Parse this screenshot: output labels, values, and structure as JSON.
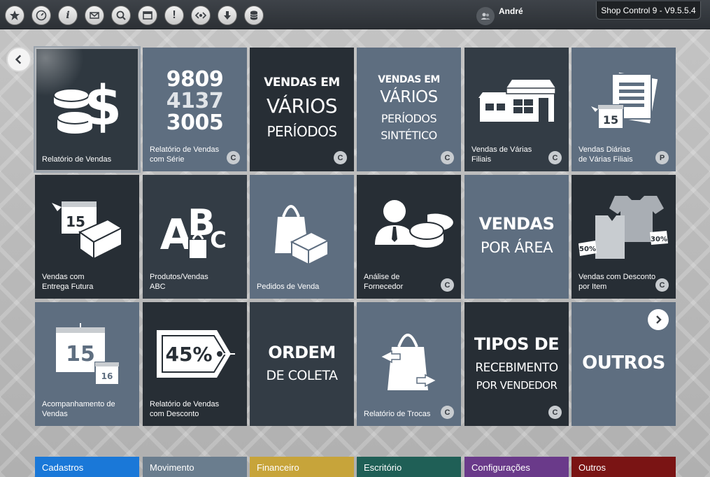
{
  "topbar": {
    "icons": [
      "star-icon",
      "dashboard-gauge-icon",
      "info-icon",
      "mail-icon",
      "search-icon",
      "window-icon",
      "alert-icon",
      "code-icon",
      "download-icon",
      "database-icon"
    ],
    "info_glyph": "i",
    "alert_glyph": "!",
    "user_name": "André",
    "version": "Shop Control 9 - V9.5.5.4"
  },
  "tiles": [
    {
      "label": "Relatório de Vendas",
      "badge": "",
      "color": "#2f3840"
    },
    {
      "label": "Relatório de Vendas\ncom Série",
      "badge": "C",
      "color": "#5e6e80",
      "numbers": [
        "9809",
        "4137",
        "3005"
      ]
    },
    {
      "label": "",
      "badge": "C",
      "color": "#272e35",
      "line1": "VENDAS EM",
      "line2": "VÁRIOS",
      "line3": "PERÍODOS"
    },
    {
      "label": "",
      "badge": "C",
      "color": "#5e6e80",
      "line1": "VENDAS EM",
      "line2": "VÁRIOS",
      "line3": "PERÍODOS",
      "line4": "SINTÉTICO"
    },
    {
      "label": "Vendas de Várias\nFiliais",
      "badge": "C",
      "color": "#333c45"
    },
    {
      "label": "Vendas Diárias\nde Várias Filiais",
      "badge": "P",
      "color": "#5e6e80",
      "day": "15"
    },
    {
      "label": "Vendas com\nEntrega Futura",
      "badge": "",
      "color": "#272e35",
      "day": "15"
    },
    {
      "label": "Produtos/Vendas\nABC",
      "badge": "",
      "color": "#333c45"
    },
    {
      "label": "Pedidos de Venda",
      "badge": "",
      "color": "#5e6e80"
    },
    {
      "label": "Análise de\nFornecedor",
      "badge": "C",
      "color": "#272e35"
    },
    {
      "label": "",
      "badge": "",
      "color": "#5e6e80",
      "line1": "VENDAS",
      "line2": "POR ÁREA"
    },
    {
      "label": "Vendas com Desconto\npor Item",
      "badge": "C",
      "color": "#272e35",
      "tag1": "50%",
      "tag2": "30%"
    },
    {
      "label": "Acompanhamento de\nVendas",
      "badge": "",
      "color": "#5e6e80",
      "day1": "15",
      "day2": "16"
    },
    {
      "label": "Relatório de Vendas\ncom Desconto",
      "badge": "",
      "color": "#272e35",
      "percent": "45%"
    },
    {
      "label": "",
      "badge": "",
      "color": "#333c45",
      "line1": "ORDEM",
      "line2": "DE COLETA"
    },
    {
      "label": "Relatório de Trocas",
      "badge": "C",
      "color": "#5e6e80"
    },
    {
      "label": "",
      "badge": "C",
      "color": "#272e35",
      "line1": "TIPOS DE",
      "line2": "RECEBIMENTO",
      "line3": "POR VENDEDOR"
    },
    {
      "label": "",
      "badge": "",
      "color": "#5e6e80",
      "line1": "OUTROS"
    }
  ],
  "bottom_tabs": [
    {
      "label": "Cadastros",
      "color": "#1a78d8"
    },
    {
      "label": "Movimento",
      "color": "#6a7d8e"
    },
    {
      "label": "Financeiro",
      "color": "#c7a43a"
    },
    {
      "label": "Escritório",
      "color": "#1f5f56"
    },
    {
      "label": "Configurações",
      "color": "#6a3a8a"
    },
    {
      "label": "Outros",
      "color": "#7a1414"
    }
  ]
}
